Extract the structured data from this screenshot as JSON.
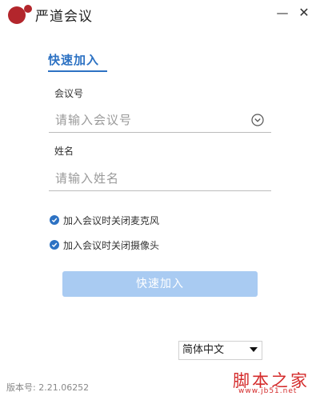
{
  "window": {
    "title": "严道会议",
    "minimize_label": "—",
    "close_label": "✕"
  },
  "tab": {
    "label": "快速加入"
  },
  "meeting_id": {
    "label": "会议号",
    "placeholder": "请输入会议号",
    "value": ""
  },
  "name": {
    "label": "姓名",
    "placeholder": "请输入姓名",
    "value": ""
  },
  "options": [
    {
      "label": "加入会议时关闭麦克风",
      "checked": true
    },
    {
      "label": "加入会议时关闭摄像头",
      "checked": true
    }
  ],
  "join_button": {
    "label": "快速加入"
  },
  "language": {
    "selected": "简体中文"
  },
  "version": {
    "text": "版本号: 2.21.06252"
  },
  "watermark": {
    "main": "脚本之家",
    "sub": "www.jb51.net"
  },
  "colors": {
    "accent": "#2d72c3",
    "brand": "#b3262c",
    "button_disabled": "#a9cbf2",
    "watermark": "#d42a2a"
  },
  "icons": {
    "logo": "app-logo-icon",
    "dropdown": "chevron-down-circle-icon",
    "check": "checkmark-icon"
  }
}
